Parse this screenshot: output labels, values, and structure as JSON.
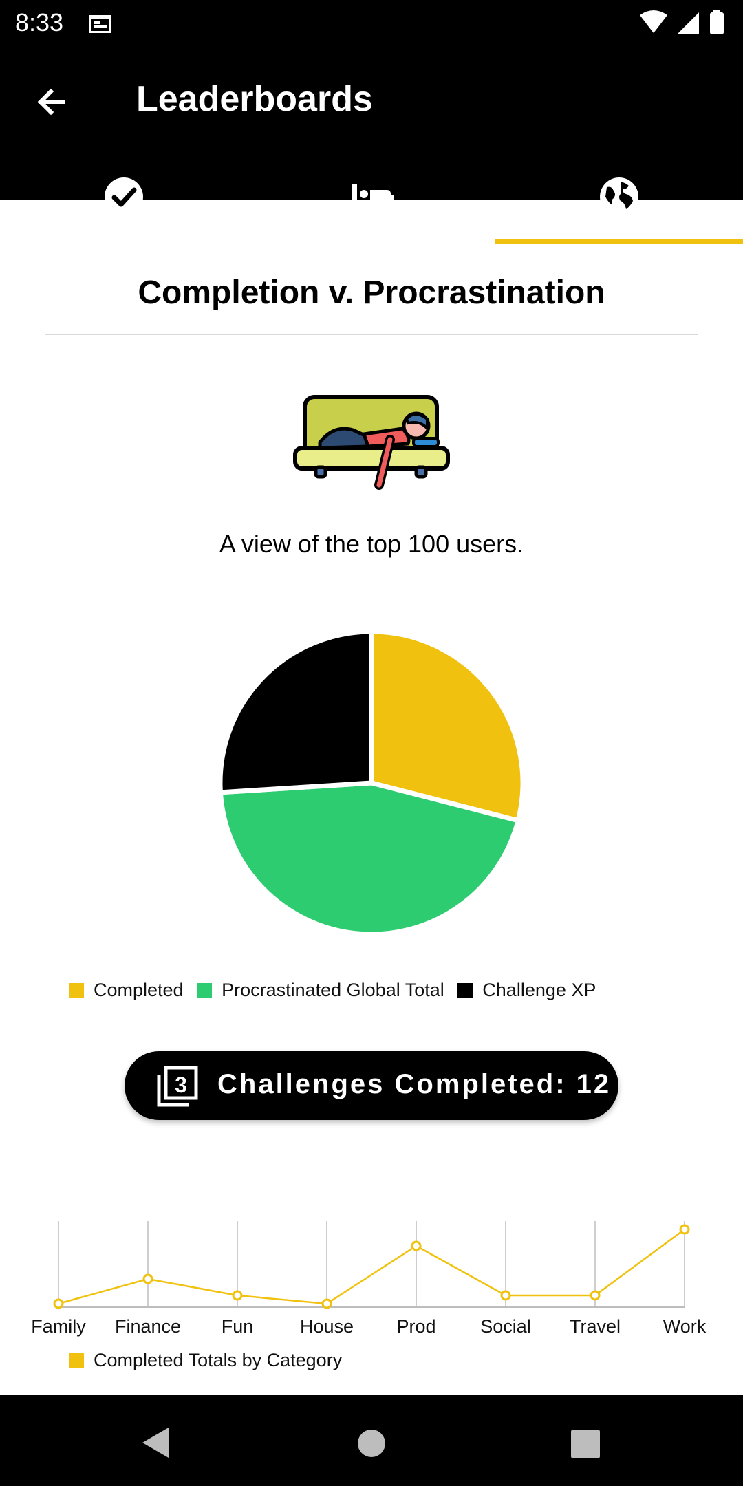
{
  "status_bar": {
    "time": "8:33"
  },
  "app_bar": {
    "title": "Leaderboards",
    "tabs": [
      {
        "name": "completed",
        "icon": "check-circle-icon"
      },
      {
        "name": "procrastinated",
        "icon": "bed-icon"
      },
      {
        "name": "global",
        "icon": "globe-icon",
        "selected": true
      }
    ],
    "accent": "#f0c20f"
  },
  "section": {
    "title": "Completion v. Procrastination",
    "subtitle": "A view of the top 100 users."
  },
  "pie_chart": {
    "type": "pie",
    "series": [
      {
        "name": "Completed",
        "value": 29,
        "color": "#f0c20f"
      },
      {
        "name": "Procrastinated Global Total",
        "value": 45,
        "color": "#2ecc71"
      },
      {
        "name": "Challenge XP",
        "value": 26,
        "color": "#000000"
      }
    ]
  },
  "challenges": {
    "label": "Challenges Completed: 12"
  },
  "chart_data": {
    "type": "line",
    "categories": [
      "Family",
      "Finance",
      "Fun",
      "House",
      "Prod",
      "Social",
      "Travel",
      "Work"
    ],
    "series": [
      {
        "name": "Completed Totals by Category",
        "values": [
          0,
          3,
          1,
          0,
          7,
          1,
          1,
          9
        ],
        "color": "#f0c20f"
      }
    ],
    "ylim": [
      0,
      10
    ],
    "grid": "vertical"
  },
  "nav": {
    "back": "back-icon",
    "home": "home-icon",
    "recents": "recents-icon"
  }
}
